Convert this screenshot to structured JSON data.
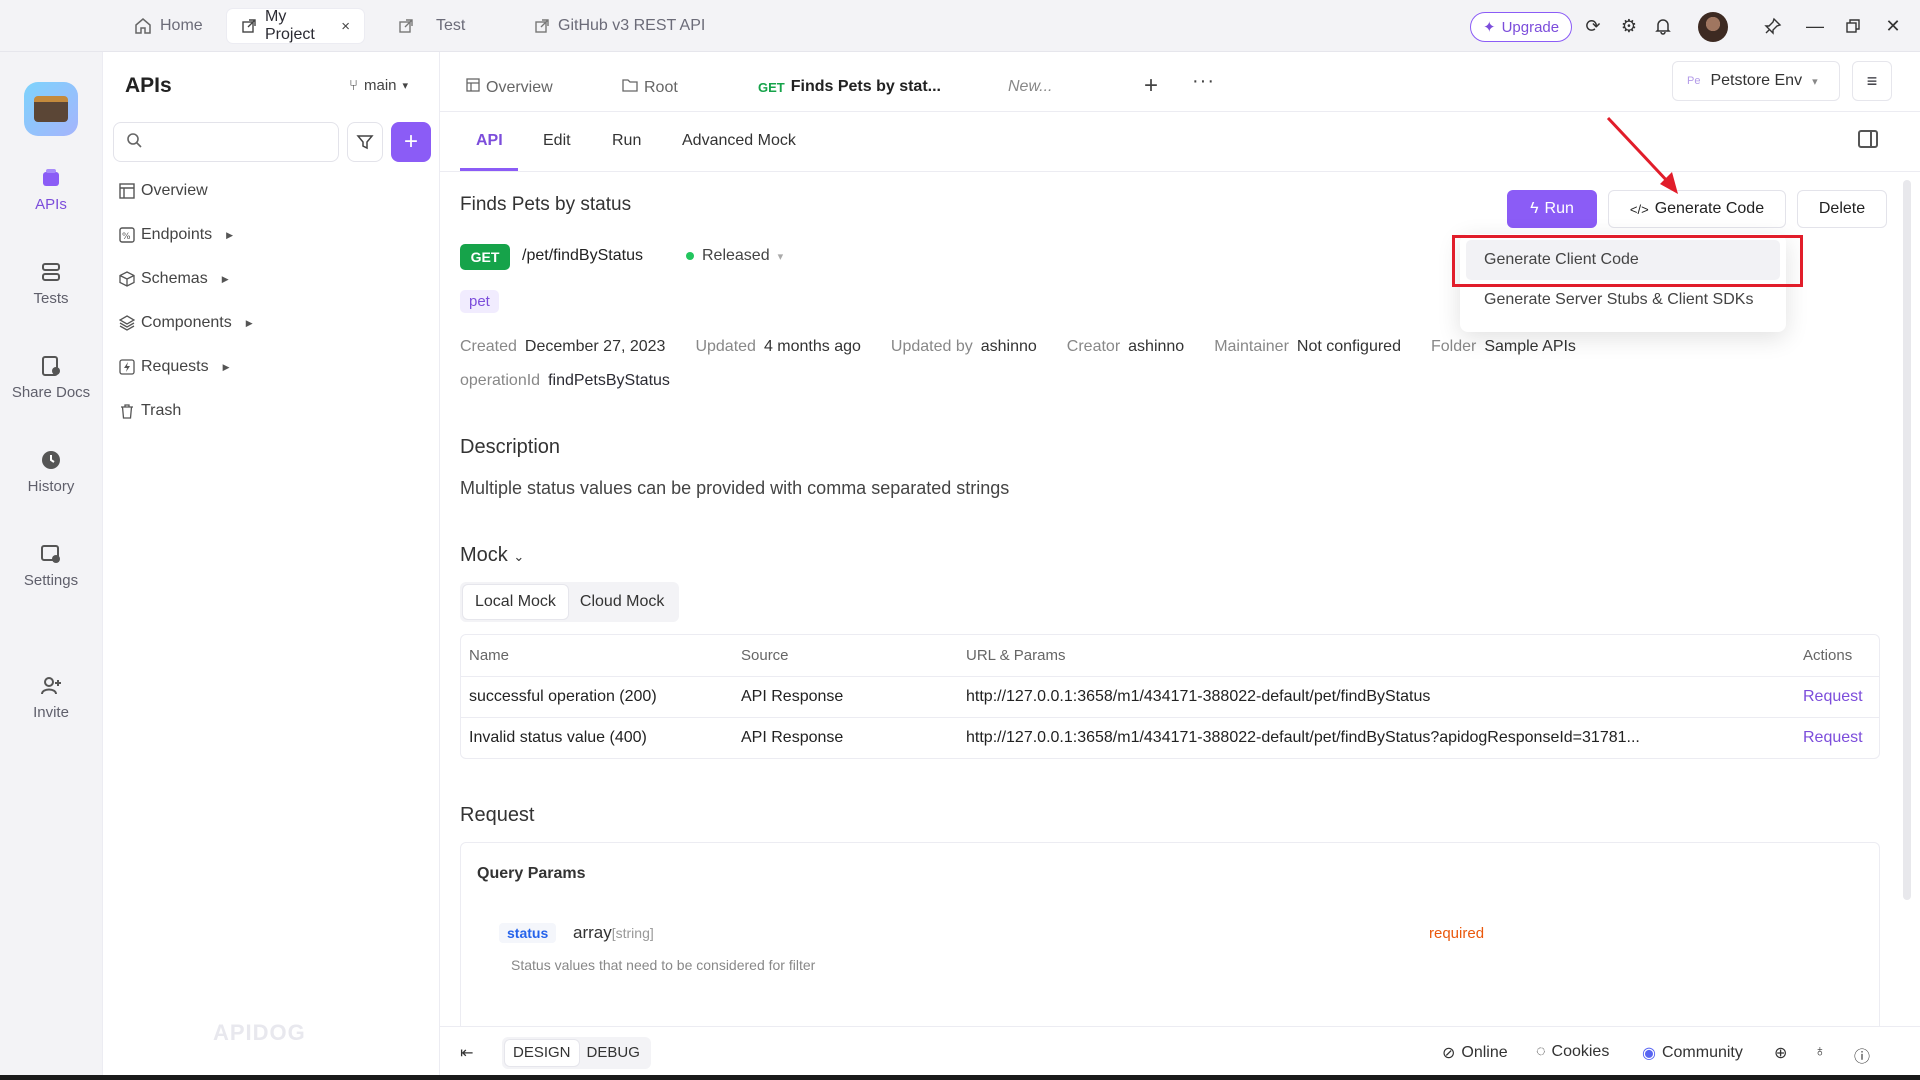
{
  "window_tabs": [
    {
      "label": "Home"
    },
    {
      "label": "My Project",
      "close": "×"
    },
    {
      "label": "Test"
    },
    {
      "label": "GitHub v3 REST API"
    }
  ],
  "titlebar": {
    "upgrade": "Upgrade"
  },
  "leftnav": [
    {
      "label": "APIs"
    },
    {
      "label": "Tests"
    },
    {
      "label": "Share Docs"
    },
    {
      "label": "History"
    },
    {
      "label": "Settings"
    },
    {
      "label": "Invite"
    }
  ],
  "sidebar": {
    "title": "APIs",
    "branch": "main",
    "search_placeholder": "",
    "items": [
      {
        "label": "Overview"
      },
      {
        "label": "Endpoints"
      },
      {
        "label": "Schemas"
      },
      {
        "label": "Components"
      },
      {
        "label": "Requests"
      },
      {
        "label": "Trash"
      }
    ],
    "watermark": "APIDOG"
  },
  "main_tabs": {
    "overview": "Overview",
    "root": "Root",
    "active_method": "GET",
    "active_label": "Finds Pets by stat...",
    "new": "New...",
    "env_prefix": "Pe",
    "env": "Petstore Env"
  },
  "sub_tabs": [
    "API",
    "Edit",
    "Run",
    "Advanced Mock"
  ],
  "endpoint": {
    "title": "Finds Pets by status",
    "run": "Run",
    "generate": "Generate Code",
    "delete": "Delete",
    "method": "GET",
    "path": "/pet/findByStatus",
    "status": "Released",
    "tag": "pet",
    "meta": [
      {
        "k": "Created",
        "v": "December 27, 2023"
      },
      {
        "k": "Updated",
        "v": "4 months ago"
      },
      {
        "k": "Updated by",
        "v": "ashinno"
      },
      {
        "k": "Creator",
        "v": "ashinno"
      },
      {
        "k": "Maintainer",
        "v": "Not configured"
      },
      {
        "k": "Folder",
        "v": "Sample APIs"
      }
    ],
    "operation_key": "operationId",
    "operation_val": "findPetsByStatus"
  },
  "description": {
    "title": "Description",
    "text": "Multiple status values can be provided with comma separated strings"
  },
  "mock": {
    "title": "Mock",
    "local": "Local Mock",
    "cloud": "Cloud Mock",
    "headers": [
      "Name",
      "Source",
      "URL & Params",
      "Actions"
    ],
    "rows": [
      {
        "name": "successful operation (200)",
        "source": "API Response",
        "url": "http://127.0.0.1:3658/m1/434171-388022-default/pet/findByStatus",
        "action": "Request"
      },
      {
        "name": "Invalid status value (400)",
        "source": "API Response",
        "url": "http://127.0.0.1:3658/m1/434171-388022-default/pet/findByStatus?apidogResponseId=31781...",
        "action": "Request"
      }
    ]
  },
  "request": {
    "title": "Request",
    "query_params": "Query Params",
    "param_name": "status",
    "param_type": "array",
    "param_subtype": "[string]",
    "param_required": "required",
    "param_desc": "Status values that need to be considered for filter"
  },
  "dropdown": {
    "items": [
      "Generate Client Code",
      "Generate Server Stubs & Client SDKs"
    ]
  },
  "footer": {
    "design": "DESIGN",
    "debug": "DEBUG",
    "online": "Online",
    "cookies": "Cookies",
    "community": "Community"
  },
  "colors": {
    "accent": "#8b5cf6",
    "get": "#16a34a",
    "annotation": "#e11d2a"
  }
}
